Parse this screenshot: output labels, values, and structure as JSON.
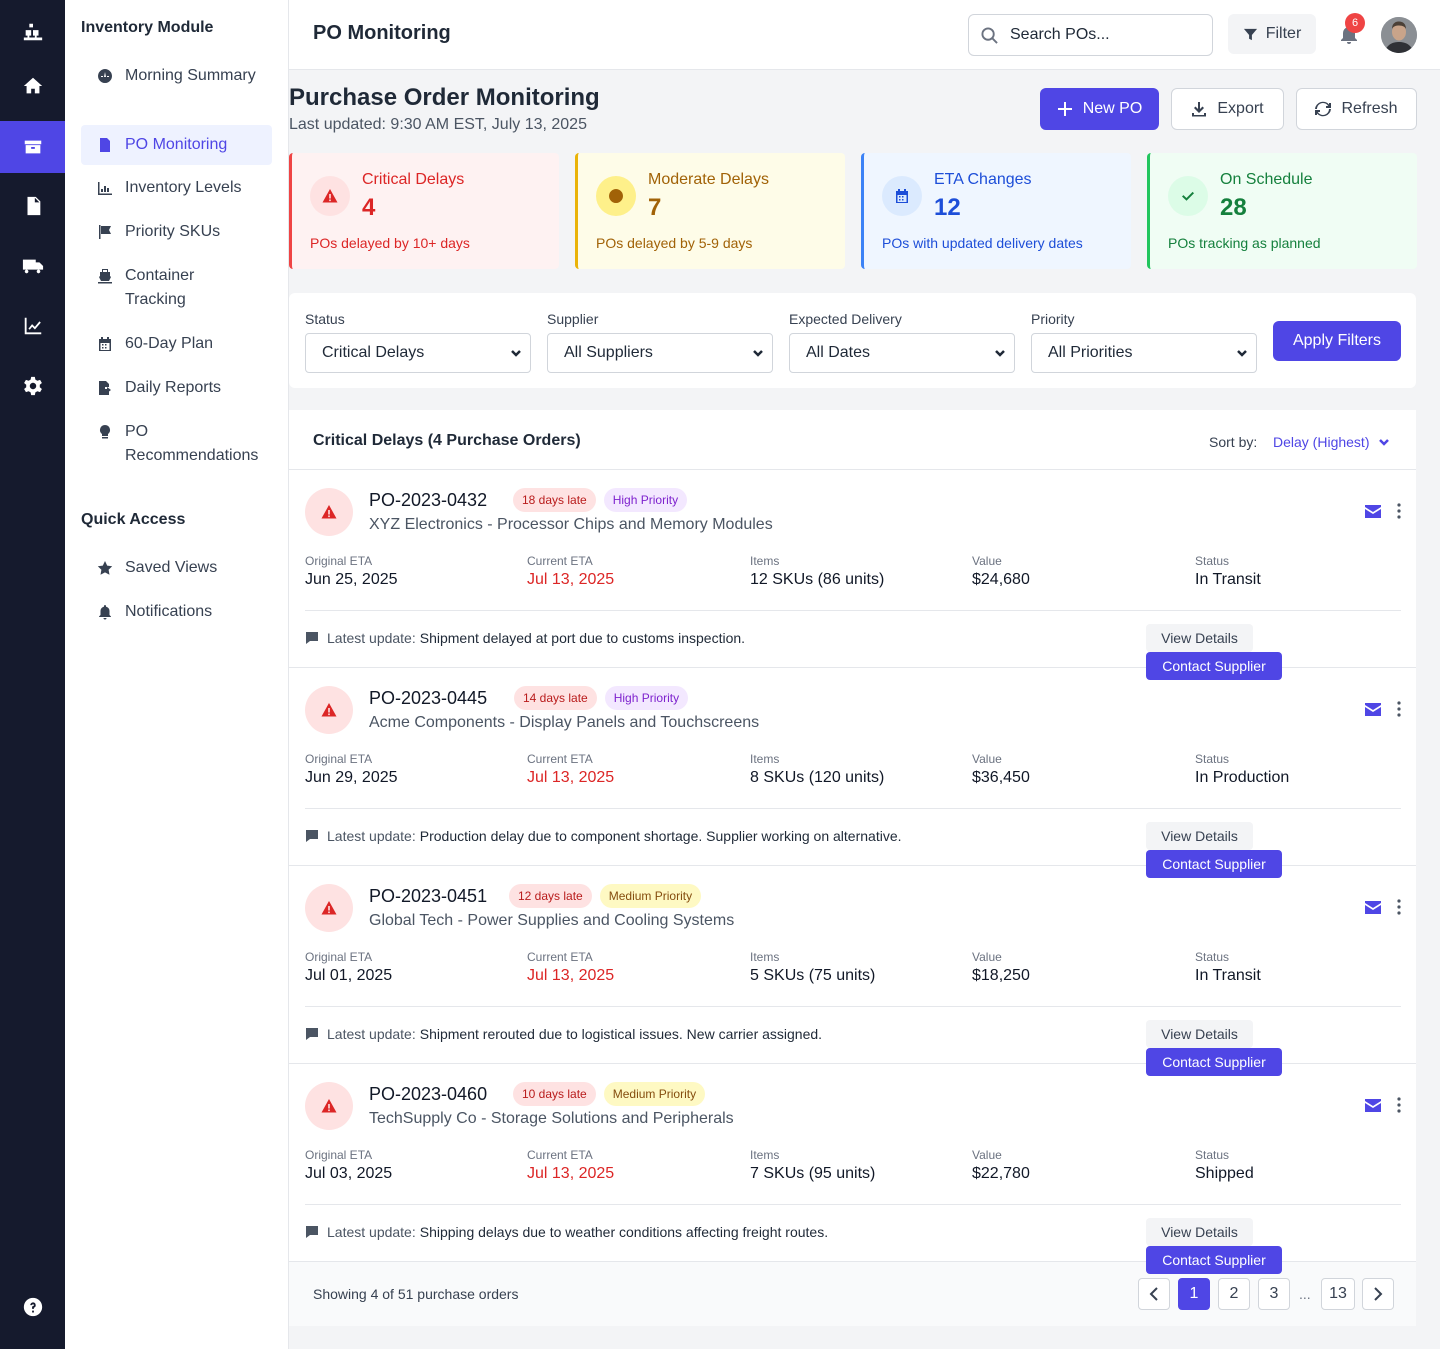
{
  "sidebar": {
    "module_title": "Inventory Module",
    "items": [
      {
        "label": "Morning Summary",
        "icon": "gauge-icon"
      },
      {
        "label": "PO Monitoring",
        "icon": "document-icon"
      },
      {
        "label": "Inventory Levels",
        "icon": "chart-bar-icon"
      },
      {
        "label": "Priority SKUs",
        "icon": "flag-icon"
      },
      {
        "label": "Container Tracking",
        "icon": "ship-icon"
      },
      {
        "label": "60-Day Plan",
        "icon": "calendar-icon"
      },
      {
        "label": "Daily Reports",
        "icon": "file-export-icon"
      },
      {
        "label": "PO Recommendations",
        "icon": "lightbulb-icon"
      }
    ],
    "quick_access_title": "Quick Access",
    "quick_items": [
      {
        "label": "Saved Views",
        "icon": "star-icon"
      },
      {
        "label": "Notifications",
        "icon": "bell-icon"
      }
    ]
  },
  "topbar": {
    "title": "PO Monitoring",
    "search_placeholder": "Search POs...",
    "filter_label": "Filter",
    "notification_count": "6"
  },
  "header": {
    "title": "Purchase Order Monitoring",
    "subtitle": "Last updated: 9:30 AM EST, July 13, 2025",
    "new_po_label": "New PO",
    "export_label": "Export",
    "refresh_label": "Refresh"
  },
  "cards": [
    {
      "title": "Critical Delays",
      "value": "4",
      "desc": "POs delayed by 10+ days",
      "color": "#dc2626",
      "bg": "#fef2f2",
      "icon_bg": "#fee2e2",
      "border": "#ef4444"
    },
    {
      "title": "Moderate Delays",
      "value": "7",
      "desc": "POs delayed by 5-9 days",
      "color": "#a16207",
      "bg": "#fefce8",
      "icon_bg": "#fef08a",
      "border": "#eab308"
    },
    {
      "title": "ETA Changes",
      "value": "12",
      "desc": "POs with updated delivery dates",
      "color": "#1d4ed8",
      "bg": "#eff6ff",
      "icon_bg": "#dbeafe",
      "border": "#3b82f6"
    },
    {
      "title": "On Schedule",
      "value": "28",
      "desc": "POs tracking as planned",
      "color": "#15803d",
      "bg": "#f0fdf4",
      "icon_bg": "#dcfce7",
      "border": "#22c55e"
    }
  ],
  "filters": {
    "status": {
      "label": "Status",
      "value": "Critical Delays"
    },
    "supplier": {
      "label": "Supplier",
      "value": "All Suppliers"
    },
    "delivery": {
      "label": "Expected Delivery",
      "value": "All Dates"
    },
    "priority": {
      "label": "Priority",
      "value": "All Priorities"
    },
    "apply_label": "Apply Filters"
  },
  "list": {
    "title": "Critical Delays (4 Purchase Orders)",
    "sort_label": "Sort by:",
    "sort_value": "Delay (Highest)",
    "field_labels": {
      "original_eta": "Original ETA",
      "current_eta": "Current ETA",
      "items": "Items",
      "value": "Value",
      "status": "Status"
    },
    "update_label": "Latest update:",
    "view_details_label": "View Details",
    "contact_label": "Contact Supplier",
    "orders": [
      {
        "id": "PO-2023-0432",
        "late": "18 days late",
        "priority": "High Priority",
        "desc": "XYZ Electronics - Processor Chips and Memory Modules",
        "original_eta": "Jun 25, 2025",
        "current_eta": "Jul 13, 2025",
        "items": "12 SKUs (86 units)",
        "value": "$24,680",
        "status": "In Transit",
        "update": "Shipment delayed at port due to customs inspection."
      },
      {
        "id": "PO-2023-0445",
        "late": "14 days late",
        "priority": "High Priority",
        "desc": "Acme Components - Display Panels and Touchscreens",
        "original_eta": "Jun 29, 2025",
        "current_eta": "Jul 13, 2025",
        "items": "8 SKUs (120 units)",
        "value": "$36,450",
        "status": "In Production",
        "update": "Production delay due to component shortage. Supplier working on alternative."
      },
      {
        "id": "PO-2023-0451",
        "late": "12 days late",
        "priority": "Medium Priority",
        "desc": "Global Tech - Power Supplies and Cooling Systems",
        "original_eta": "Jul 01, 2025",
        "current_eta": "Jul 13, 2025",
        "items": "5 SKUs (75 units)",
        "value": "$18,250",
        "status": "In Transit",
        "update": "Shipment rerouted due to logistical issues. New carrier assigned."
      },
      {
        "id": "PO-2023-0460",
        "late": "10 days late",
        "priority": "Medium Priority",
        "desc": "TechSupply Co - Storage Solutions and Peripherals",
        "original_eta": "Jul 03, 2025",
        "current_eta": "Jul 13, 2025",
        "items": "7 SKUs (95 units)",
        "value": "$22,780",
        "status": "Shipped",
        "update": "Shipping delays due to weather conditions affecting freight routes."
      }
    ],
    "showing": "Showing 4 of 51 purchase orders",
    "pages": [
      "1",
      "2",
      "3",
      "13"
    ],
    "ellipsis": "..."
  }
}
